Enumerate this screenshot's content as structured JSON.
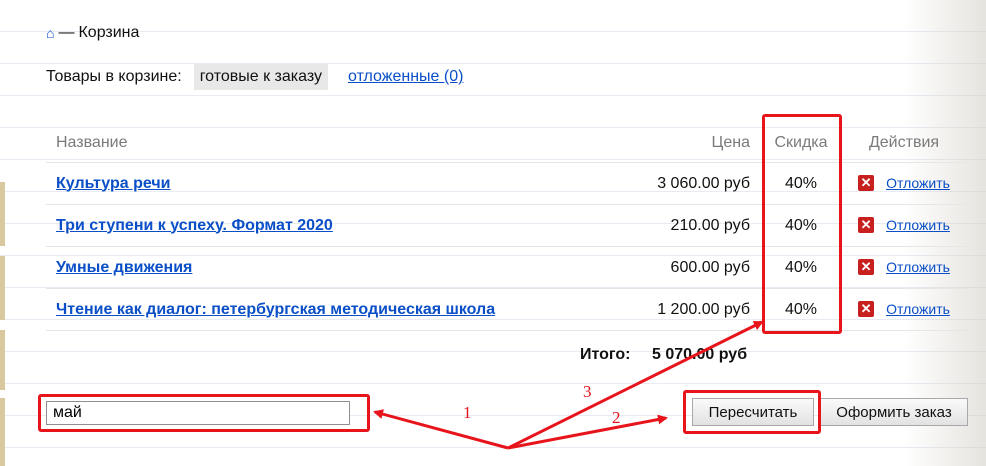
{
  "breadcrumb": {
    "home_icon": "home-icon",
    "separator": "—",
    "current": "Корзина"
  },
  "tabs": {
    "label": "Товары в корзине:",
    "active": "готовые к заказу",
    "deferred": "отложенные (0)"
  },
  "table": {
    "headers": {
      "name": "Название",
      "price": "Цена",
      "discount": "Скидка",
      "actions": "Действия"
    },
    "rows": [
      {
        "name": "Культура речи",
        "price": "3 060.00 руб",
        "discount": "40%",
        "action": "Отложить"
      },
      {
        "name": "Три ступени к успеху. Формат 2020",
        "price": "210.00 руб",
        "discount": "40%",
        "action": "Отложить"
      },
      {
        "name": "Умные движения",
        "price": "600.00 руб",
        "discount": "40%",
        "action": "Отложить"
      },
      {
        "name": "Чтение как диалог: петербургская методическая школа",
        "price": "1 200.00 руб",
        "discount": "40%",
        "action": "Отложить"
      }
    ],
    "delete_symbol": "✕"
  },
  "total": {
    "label": "Итого:",
    "value": "5 070.00 руб"
  },
  "promo": {
    "value": "май"
  },
  "buttons": {
    "recalculate": "Пересчитать",
    "checkout": "Оформить заказ"
  },
  "annotations": {
    "one": "1",
    "two": "2",
    "three": "3"
  },
  "colors": {
    "link": "#0a4fc7",
    "annotation": "#e8141b",
    "delete": "#c8201f"
  }
}
